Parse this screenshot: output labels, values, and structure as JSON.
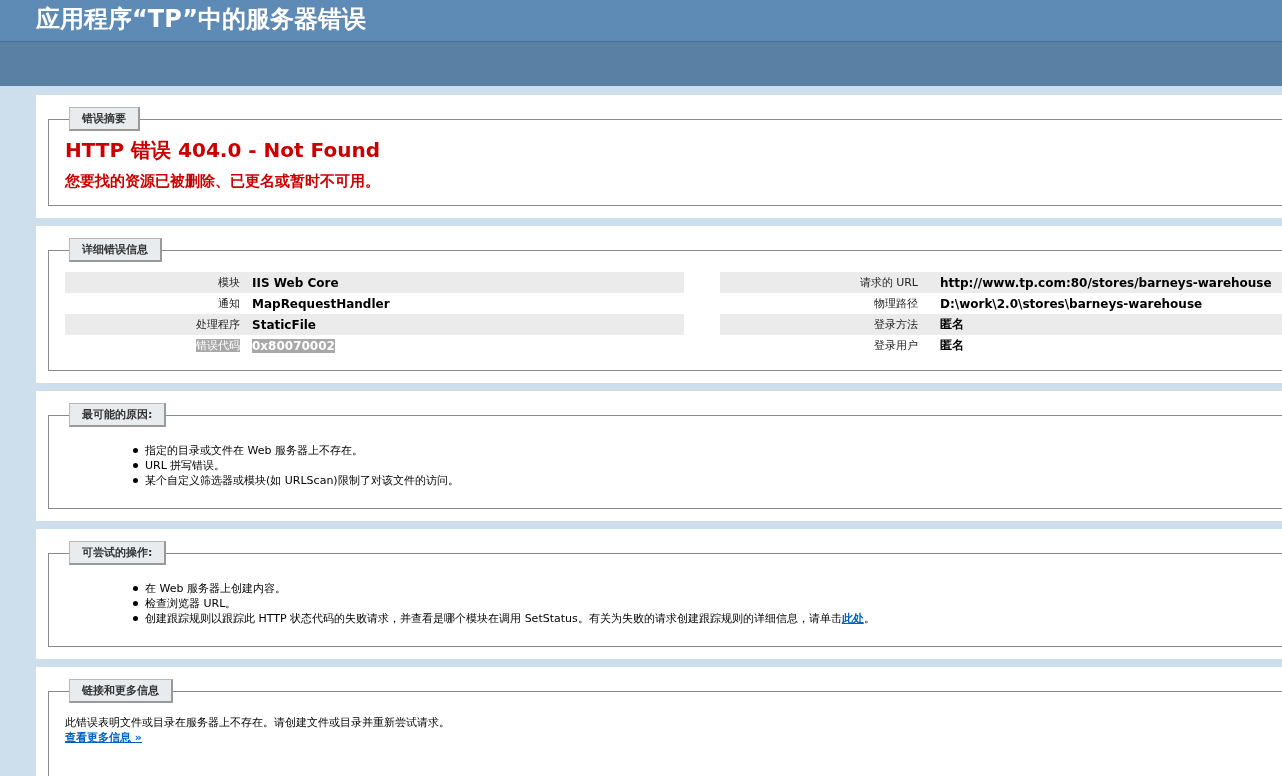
{
  "header": {
    "title": "应用程序“TP”中的服务器错误"
  },
  "sections": [
    {
      "kind": "summary",
      "legend": "错误摘要",
      "heading": "HTTP 错误 404.0 - Not Found",
      "message": "您要找的资源已被删除、已更名或暂时不可用。"
    },
    {
      "kind": "details",
      "legend": "详细错误信息",
      "left": [
        {
          "label": "模块",
          "value": "IIS Web Core",
          "highlighted": false
        },
        {
          "label": "通知",
          "value": "MapRequestHandler",
          "highlighted": false
        },
        {
          "label": "处理程序",
          "value": "StaticFile",
          "highlighted": false
        },
        {
          "label": "错误代码",
          "value": "0x80070002",
          "highlighted": true
        }
      ],
      "right": [
        {
          "label": "请求的 URL",
          "value": "http://www.tp.com:80/stores/barneys-warehouse"
        },
        {
          "label": "物理路径",
          "value": "D:\\work\\2.0\\stores\\barneys-warehouse"
        },
        {
          "label": "登录方法",
          "value": "匿名"
        },
        {
          "label": "登录用户",
          "value": "匿名"
        }
      ]
    },
    {
      "kind": "list",
      "legend": "最可能的原因:",
      "items": [
        {
          "text": "指定的目录或文件在 Web 服务器上不存在。"
        },
        {
          "text": "URL 拼写错误。"
        },
        {
          "text": "某个自定义筛选器或模块(如 URLScan)限制了对该文件的访问。"
        }
      ]
    },
    {
      "kind": "list",
      "legend": "可尝试的操作:",
      "items": [
        {
          "text": "在 Web 服务器上创建内容。"
        },
        {
          "text": "检查浏览器 URL。"
        },
        {
          "text": "创建跟踪规则以跟踪此 HTTP 状态代码的失败请求，并查看是哪个模块在调用 SetStatus。有关为失败的请求创建跟踪规则的详细信息，请单击",
          "link": "此处",
          "after": "。"
        }
      ]
    },
    {
      "kind": "text",
      "legend": "链接和更多信息",
      "text": "此错误表明文件或目录在服务器上不存在。请创建文件或目录并重新尝试请求。",
      "link": "查看更多信息 »"
    }
  ]
}
